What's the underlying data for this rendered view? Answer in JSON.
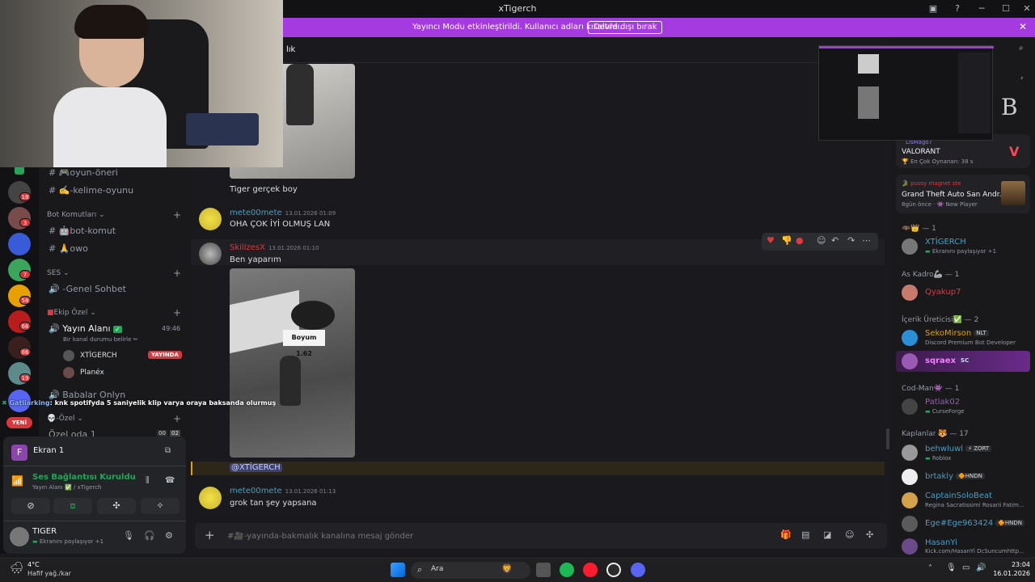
{
  "window": {
    "title": "xTigerch"
  },
  "banner": {
    "message": "Yayıncı Modu etkinleştirildi. Kullanıcı adları kısaltıldı.",
    "button": "Devre dışı bırak"
  },
  "chat_header": {
    "channel": "lık"
  },
  "channels": {
    "items": [
      {
        "label": "🎮oyun-öneri"
      },
      {
        "label": "✍️-kelime-oyunu"
      }
    ],
    "cat_bot": "Bot Komutları",
    "bot_items": [
      {
        "label": "🤖bot-komut"
      },
      {
        "label": "🙏owo"
      }
    ],
    "cat_ses": "SES",
    "ses_items": [
      {
        "label": "-Genel Sohbet"
      }
    ],
    "cat_ekip": "Ekip Özel",
    "voice": {
      "name": "Yayın Alanı",
      "timer": "49:46",
      "status": "Bir kanal durumu belirle"
    },
    "voice_users": [
      {
        "name": "XTİGERCH",
        "badge": "YAYINDA"
      },
      {
        "name": "Planéx"
      }
    ],
    "babalar": "Babalar Onlyn",
    "cat_ozel": "-Özel",
    "ozel_oda": "Özel oda 1",
    "ozel_counts": [
      "00",
      "02"
    ]
  },
  "overlay_chat": {
    "user": "Gatliarking",
    "text": ": knk spotifyda 5 saniyelik klip varya oraya baksanda olurmuş"
  },
  "servers": {
    "new_label": "YENİ",
    "badges": [
      "18",
      "3",
      "7",
      "58",
      "66",
      "86",
      "19"
    ]
  },
  "user_panel": {
    "screen": "Ekran 1",
    "conn_title": "Ses Bağlantısı Kuruldu",
    "conn_sub": "Yayın Alanı ✅ / xTigerch",
    "username": "TIGER",
    "user_status": "Ekranını paylaşıyor +1"
  },
  "messages": [
    {
      "type": "text",
      "text": "Tiger gerçek boy"
    },
    {
      "user": "mete00mete",
      "time": "13.01.2026 01:09",
      "text": "OHA ÇOK İYİ OLMUŞ LAN",
      "color": "#3ba2cf"
    },
    {
      "user": "SkillzesX",
      "time": "13.01.2026 01:10",
      "text": "Ben yaparım",
      "color": "#e0383e"
    },
    {
      "type": "mention",
      "text": "@XTİGERCH"
    },
    {
      "user": "mete00mete",
      "time": "13.01.2026 01:13",
      "text": "grok tan şey yapsana",
      "color": "#3ba2cf"
    }
  ],
  "image_sign": "Boyum 1.62",
  "composer": {
    "placeholder": "#🎥-yayında-bakmalık kanalına mesaj gönder"
  },
  "activity": [
    {
      "user": "LisMago7",
      "game": "VALORANT",
      "detail": "En Çok Oynanan: 38 s"
    },
    {
      "user": "pussy magnet ste",
      "game": "Grand Theft Auto San Andr...",
      "detail": "8gün önce",
      "detail2": "New Player"
    }
  ],
  "members": {
    "sec1": "🦇👑 — 1",
    "m1": {
      "name": "XTİGERCH",
      "sub": "Ekranını paylaşıyor +1"
    },
    "sec2": "As Kadro🦾 — 1",
    "m2": {
      "name": "Qyakup7"
    },
    "sec3": "İçerik Üreticisi✅ — 2",
    "m3": {
      "name": "SekoMirson",
      "tag": "NLT",
      "sub": "Discord Premium Bot Developer"
    },
    "m4": {
      "name": "sqraex",
      "tag": "SC"
    },
    "sec4": "Cod-Man👾 — 1",
    "m5": {
      "name": "Patlak02",
      "sub": "CurseForge"
    },
    "sec5": "Kaplanlar 🐯 — 17",
    "m6": {
      "name": "behwluwl",
      "tag": "ZORT",
      "sub": "Roblox"
    },
    "m7": {
      "name": "brtakly",
      "tag": "HNDN"
    },
    "m8": {
      "name": "CaptainSoloBeat",
      "sub": "Regina Sacratissimi Rosarii Fatim..."
    },
    "m9": {
      "name": "Ege#Ege963424",
      "tag": "HNDN"
    },
    "m10": {
      "name": "HasanYi",
      "sub": "Kick.com/HasanYi DcSuncumhttp..."
    }
  },
  "taskbar": {
    "weather_temp": "4°C",
    "weather_desc": "Hafif yağ./kar",
    "search": "Ara",
    "time": "23:04",
    "date": "16.01.2026"
  },
  "colors": {
    "accent": "#a43ae0",
    "danger": "#da373c",
    "online": "#23a55a"
  }
}
